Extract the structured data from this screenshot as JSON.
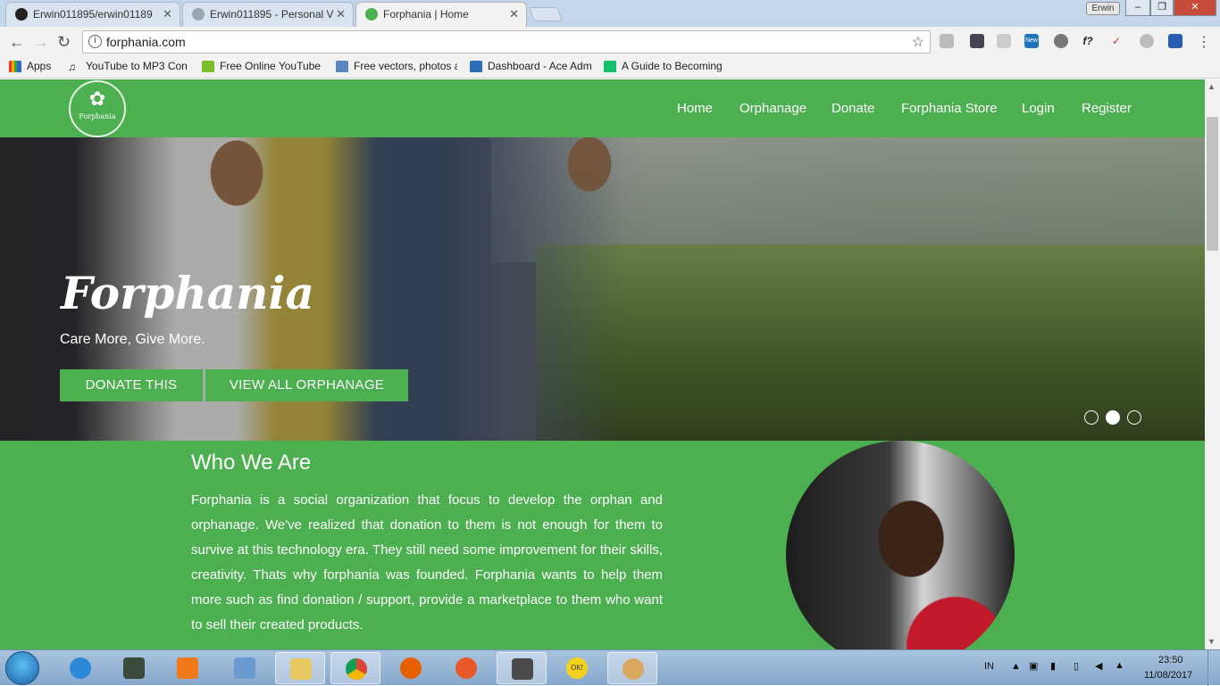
{
  "browser": {
    "tabs": [
      {
        "label": "Erwin011895/erwin01189",
        "active": false
      },
      {
        "label": "Erwin011895 - Personal V",
        "active": false
      },
      {
        "label": "Forphania | Home",
        "active": true
      }
    ],
    "profile_name": "Erwin",
    "address": "forphania.com",
    "bookmarks": [
      "Apps",
      "YouTube to MP3 Con",
      "Free Online YouTube",
      "Free vectors, photos a",
      "Dashboard - Ace Adm",
      "A Guide to Becoming"
    ],
    "extension_labels": {
      "new_badge": "New",
      "f_icon": "f?"
    }
  },
  "site": {
    "logo_text": "Forphania",
    "nav": [
      "Home",
      "Orphanage",
      "Donate",
      "Forphania Store",
      "Login",
      "Register"
    ],
    "hero": {
      "title": "Forphania",
      "subtitle": "Care More, Give More.",
      "primary_button": "DONATE THIS",
      "secondary_button": "VIEW ALL ORPHANAGE",
      "slides": 3,
      "active_slide": 2
    },
    "about": {
      "title": "Who We Are",
      "text": "Forphania is a social organization that focus to develop the orphan and orphanage. We've realized that donation to them is not enough for them to survive at this technology era. They still need some improvement for their skills, creativity. Thats why forphania was founded. Forphania wants to help them more such as find donation / support, provide a marketplace to them who want to sell their created products."
    }
  },
  "taskbar": {
    "language": "IN",
    "time": "23:50",
    "date": "11/08/2017",
    "sticker_text": "OK!"
  },
  "colors": {
    "brand_green": "#4caf50"
  }
}
